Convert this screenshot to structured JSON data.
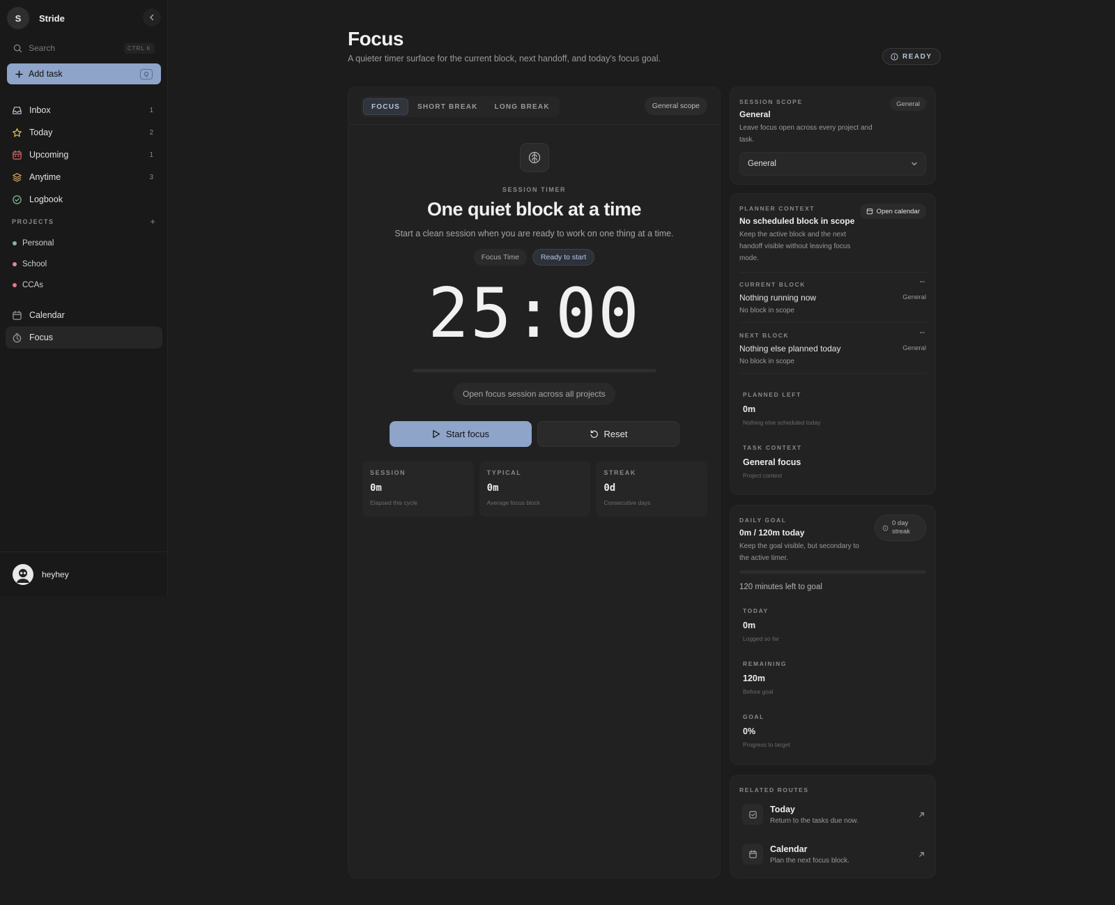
{
  "sidebar": {
    "brand_initial": "S",
    "brand_name": "Stride",
    "search_placeholder": "Search",
    "search_shortcut": "CTRL K",
    "add_task_label": "Add task",
    "add_task_shortcut": "Q",
    "nav": [
      {
        "label": "Inbox",
        "count": "1",
        "icon": "inbox-icon"
      },
      {
        "label": "Today",
        "count": "2",
        "icon": "star-icon"
      },
      {
        "label": "Upcoming",
        "count": "1",
        "icon": "calendar-icon"
      },
      {
        "label": "Anytime",
        "count": "3",
        "icon": "layers-icon"
      },
      {
        "label": "Logbook",
        "count": "",
        "icon": "check-circle-icon"
      }
    ],
    "projects_heading": "PROJECTS",
    "projects": [
      {
        "label": "Personal",
        "color": "#7fb8a4"
      },
      {
        "label": "School",
        "color": "#d98a9c"
      },
      {
        "label": "CCAs",
        "color": "#e07a86"
      }
    ],
    "nav2": [
      {
        "label": "Calendar",
        "icon": "calendar-icon"
      },
      {
        "label": "Focus",
        "icon": "timer-icon"
      }
    ],
    "user_name": "heyhey"
  },
  "header": {
    "title": "Focus",
    "subtitle": "A quieter timer surface for the current block, next handoff, and today's focus goal.",
    "status_badge": "READY"
  },
  "timer_panel": {
    "tabs": [
      "FOCUS",
      "SHORT BREAK",
      "LONG BREAK"
    ],
    "active_tab": "FOCUS",
    "scope_pill": "General scope",
    "eyebrow": "SESSION TIMER",
    "heading": "One quiet block at a time",
    "subheading": "Start a clean session when you are ready to work on one thing at a time.",
    "chip_mode": "Focus Time",
    "chip_status": "Ready to start",
    "time": "25:00",
    "progress": 0,
    "scope_note": "Open focus session across all projects",
    "start_label": "Start focus",
    "reset_label": "Reset",
    "stats": [
      {
        "label": "SESSION",
        "value": "0m",
        "note": "Elapsed this cycle"
      },
      {
        "label": "TYPICAL",
        "value": "0m",
        "note": "Average focus block"
      },
      {
        "label": "STREAK",
        "value": "0d",
        "note": "Consecutive days"
      }
    ]
  },
  "session_scope": {
    "eyebrow": "SESSION SCOPE",
    "title": "General",
    "pill": "General",
    "desc": "Leave focus open across every project and task.",
    "select_value": "General"
  },
  "planner": {
    "eyebrow": "PLANNER CONTEXT",
    "title": "No scheduled block in scope",
    "desc": "Keep the active block and the next handoff visible without leaving focus mode.",
    "open_calendar": "Open calendar",
    "current_eyebrow": "CURRENT BLOCK",
    "current_title": "Nothing running now",
    "current_note": "No block in scope",
    "current_dash": "--",
    "current_tag": "General",
    "next_eyebrow": "NEXT BLOCK",
    "next_title": "Nothing else planned today",
    "next_note": "No block in scope",
    "next_dash": "--",
    "next_tag": "General",
    "planned_label": "PLANNED LEFT",
    "planned_value": "0m",
    "planned_note": "Nothing else scheduled today",
    "task_label": "TASK CONTEXT",
    "task_value": "General focus",
    "task_note": "Project context"
  },
  "daily_goal": {
    "eyebrow": "DAILY GOAL",
    "title": "0m / 120m today",
    "desc": "Keep the goal visible, but secondary to the active timer.",
    "streak_line1": "0 day",
    "streak_line2": "streak",
    "progress": 0,
    "left_text": "120 minutes left to goal",
    "today_label": "TODAY",
    "today_value": "0m",
    "today_note": "Logged so far",
    "remaining_label": "REMAINING",
    "remaining_value": "120m",
    "remaining_note": "Before goal",
    "goal_label": "GOAL",
    "goal_value": "0%",
    "goal_note": "Progress to target"
  },
  "related": {
    "eyebrow": "RELATED ROUTES",
    "routes": [
      {
        "title": "Today",
        "desc": "Return to the tasks due now."
      },
      {
        "title": "Calendar",
        "desc": "Plan the next focus block."
      }
    ]
  },
  "colors": {
    "accent": "#8ea4c9",
    "background": "#1c1c1c",
    "surface": "#222222"
  }
}
